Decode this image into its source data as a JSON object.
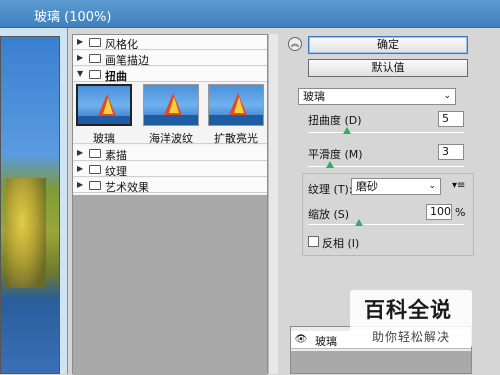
{
  "window": {
    "title": "玻璃 (100%)"
  },
  "gallery": {
    "categories": [
      {
        "label": "风格化",
        "expanded": false
      },
      {
        "label": "画笔描边",
        "expanded": false
      },
      {
        "label": "扭曲",
        "expanded": true
      },
      {
        "label": "素描",
        "expanded": false
      },
      {
        "label": "纹理",
        "expanded": false
      },
      {
        "label": "艺术效果",
        "expanded": false
      }
    ],
    "distort_filters": [
      {
        "label": "玻璃",
        "selected": true
      },
      {
        "label": "海洋波纹",
        "selected": false
      },
      {
        "label": "扩散亮光",
        "selected": false
      }
    ]
  },
  "buttons": {
    "ok": "确定",
    "default": "默认值",
    "collapse_icon": "double-chevron-up-icon"
  },
  "settings": {
    "filter_select": "玻璃",
    "distortion": {
      "label": "扭曲度 (D)",
      "value": "5",
      "fraction": 0.25
    },
    "smoothness": {
      "label": "平滑度 (M)",
      "value": "3",
      "fraction": 0.14
    },
    "texture": {
      "label": "纹理 (T):",
      "value": "磨砂",
      "menu_icon": "panel-menu-icon"
    },
    "scaling": {
      "label": "缩放 (S)",
      "value": "100",
      "unit": "%",
      "fraction": 0.33
    },
    "invert": {
      "label": "反相 (I)",
      "checked": false
    }
  },
  "layers": {
    "items": [
      {
        "name": "玻璃",
        "visible": true
      }
    ]
  },
  "watermark": {
    "title": "百科全说",
    "subtitle": "助你轻松解决"
  },
  "colors": {
    "titlebar": "#4a8cc9",
    "panel": "#d6d6d6",
    "accent": "#3b77c6"
  }
}
